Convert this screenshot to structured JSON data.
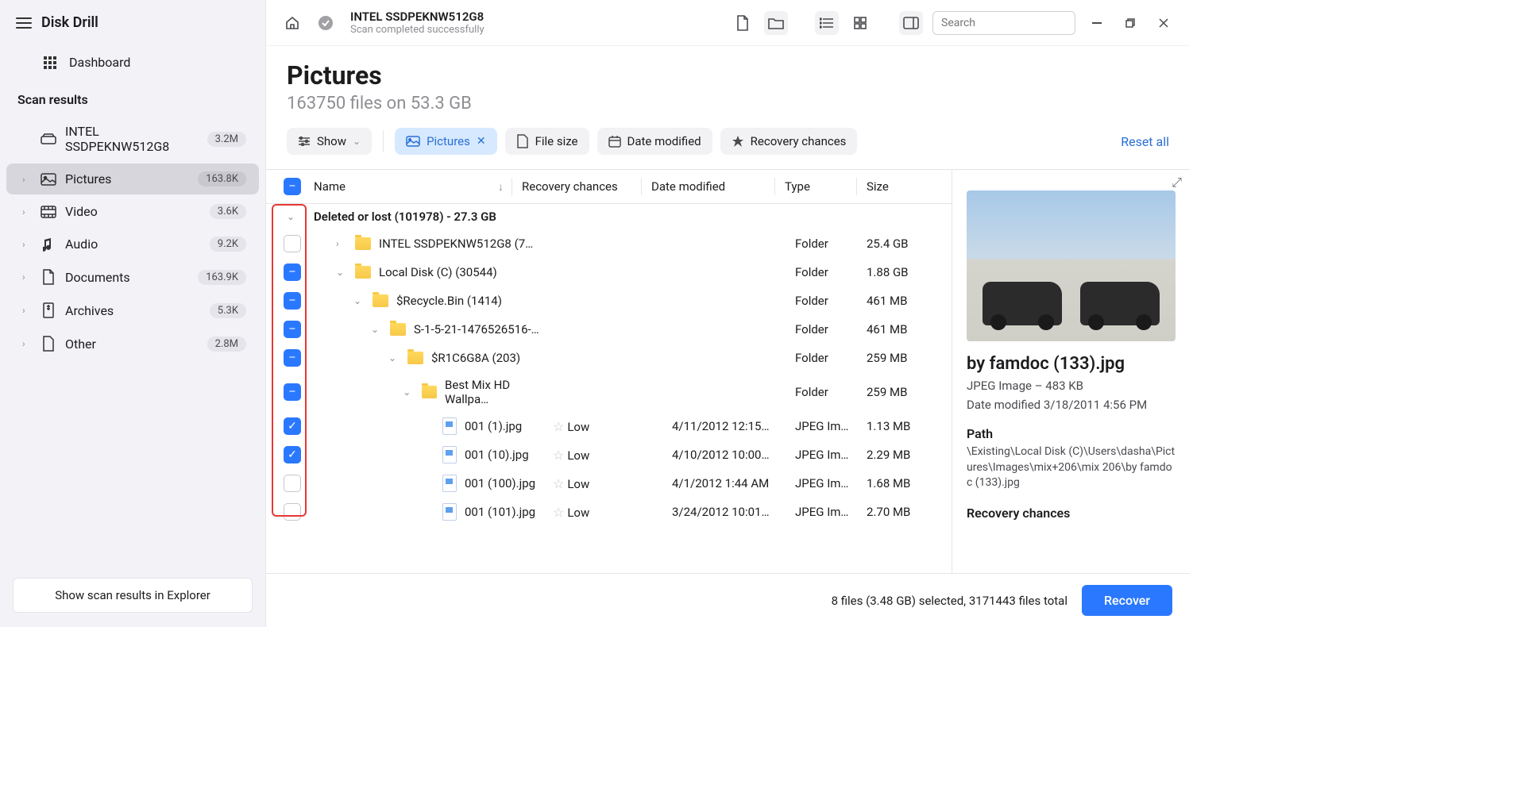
{
  "app_title": "Disk Drill",
  "sidebar": {
    "dashboard": "Dashboard",
    "section": "Scan results",
    "drive": {
      "name": "INTEL SSDPEKNW512G8",
      "count": "3.2M"
    },
    "items": [
      {
        "label": "Pictures",
        "count": "163.8K"
      },
      {
        "label": "Video",
        "count": "3.6K"
      },
      {
        "label": "Audio",
        "count": "9.2K"
      },
      {
        "label": "Documents",
        "count": "163.9K"
      },
      {
        "label": "Archives",
        "count": "5.3K"
      },
      {
        "label": "Other",
        "count": "2.8M"
      }
    ],
    "footer_button": "Show scan results in Explorer"
  },
  "header": {
    "title": "INTEL SSDPEKNW512G8",
    "subtitle": "Scan completed successfully",
    "search_placeholder": "Search"
  },
  "page": {
    "title": "Pictures",
    "subtitle": "163750 files on 53.3 GB"
  },
  "filters": {
    "show": "Show",
    "pictures": "Pictures",
    "file_size": "File size",
    "date_modified": "Date modified",
    "recovery_chances": "Recovery chances",
    "reset": "Reset all"
  },
  "columns": {
    "name": "Name",
    "recovery": "Recovery chances",
    "date": "Date modified",
    "type": "Type",
    "size": "Size"
  },
  "group_header": "Deleted or lost (101978) - 27.3 GB",
  "rows": [
    {
      "chk": "empty",
      "depth": 0,
      "toggle": "right",
      "kind": "folder",
      "name": "INTEL SSDPEKNW512G8 (7…",
      "rec": "",
      "date": "",
      "type": "Folder",
      "size": "25.4 GB"
    },
    {
      "chk": "minus",
      "depth": 0,
      "toggle": "down",
      "kind": "folder",
      "name": "Local Disk (C) (30544)",
      "rec": "",
      "date": "",
      "type": "Folder",
      "size": "1.88 GB"
    },
    {
      "chk": "minus",
      "depth": 1,
      "toggle": "down",
      "kind": "folder",
      "name": "$Recycle.Bin (1414)",
      "rec": "",
      "date": "",
      "type": "Folder",
      "size": "461 MB"
    },
    {
      "chk": "minus",
      "depth": 2,
      "toggle": "down",
      "kind": "folder",
      "name": "S-1-5-21-1476526516-…",
      "rec": "",
      "date": "",
      "type": "Folder",
      "size": "461 MB"
    },
    {
      "chk": "minus",
      "depth": 3,
      "toggle": "down",
      "kind": "folder",
      "name": "$R1C6G8A (203)",
      "rec": "",
      "date": "",
      "type": "Folder",
      "size": "259 MB"
    },
    {
      "chk": "minus",
      "depth": 4,
      "toggle": "down",
      "kind": "folder",
      "name": "Best Mix HD Wallpa…",
      "rec": "",
      "date": "",
      "type": "Folder",
      "size": "259 MB"
    },
    {
      "chk": "check",
      "depth": 5,
      "toggle": "",
      "kind": "file",
      "name": "001 (1).jpg",
      "rec": "Low",
      "date": "4/11/2012 12:15…",
      "type": "JPEG Im…",
      "size": "1.13 MB"
    },
    {
      "chk": "check",
      "depth": 5,
      "toggle": "",
      "kind": "file",
      "name": "001 (10).jpg",
      "rec": "Low",
      "date": "4/10/2012 10:00…",
      "type": "JPEG Im…",
      "size": "2.29 MB"
    },
    {
      "chk": "empty",
      "depth": 5,
      "toggle": "",
      "kind": "file",
      "name": "001 (100).jpg",
      "rec": "Low",
      "date": "4/1/2012 1:44 AM",
      "type": "JPEG Im…",
      "size": "1.68 MB"
    },
    {
      "chk": "empty",
      "depth": 5,
      "toggle": "",
      "kind": "file",
      "name": "001 (101).jpg",
      "rec": "Low",
      "date": "3/24/2012 10:01…",
      "type": "JPEG Im…",
      "size": "2.70 MB"
    }
  ],
  "preview": {
    "title": "by famdoc (133).jpg",
    "meta": "JPEG Image – 483 KB",
    "modified": "Date modified 3/18/2011 4:56 PM",
    "path_label": "Path",
    "path": "\\Existing\\Local Disk (C)\\Users\\dasha\\Pictures\\Images\\mix+206\\mix 206\\by famdoc (133).jpg",
    "recovery_label": "Recovery chances"
  },
  "footer": {
    "status": "8 files (3.48 GB) selected, 3171443 files total",
    "recover": "Recover"
  }
}
